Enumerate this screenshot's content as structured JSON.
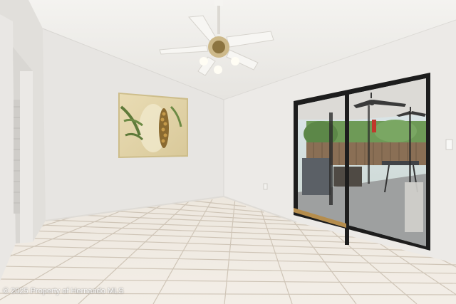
{
  "photo": {
    "watermark": "© 2025 Property of Hernando MLS",
    "colors": {
      "wall": "#eceae7",
      "ceiling": "#f1f0ed",
      "tile": "#efe9e0",
      "grout": "#c9bfb2",
      "door_frame": "#1d1d1d"
    }
  }
}
